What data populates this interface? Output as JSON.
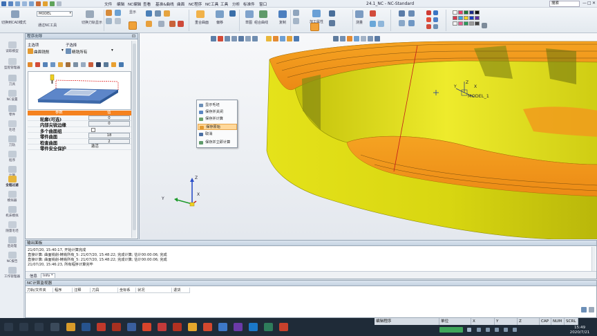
{
  "window": {
    "title": "24.1_NC - NC-Standard",
    "search_placeholder": "搜索",
    "controls": [
      "—",
      "□",
      "✕"
    ]
  },
  "menus": [
    "文件",
    "编辑",
    "NC编辑",
    "查看",
    "基准&曲线",
    "曲面",
    "NC程序",
    "NC工具",
    "工具",
    "分析",
    "标准件",
    "窗口"
  ],
  "ribbon": {
    "combo_value": "MODEL",
    "labels": {
      "switch_cad": "切换到CAD模式",
      "via_nc_tool": "通过NC工具",
      "switch_display": "切换刀轨显示",
      "collapse": "显示",
      "part_compare": "重合曲面",
      "offset": "偏移",
      "sketch": "草图",
      "combine_curves": "组合曲线",
      "copy": "复制",
      "machining_attr": "加工属性",
      "measure": "测量",
      "rotate": "旋转"
    }
  },
  "vtool": [
    {
      "icon": "import-model-icon",
      "label": "读取模型"
    },
    {
      "icon": "section-management-icon",
      "label": "型腔管理器"
    },
    {
      "icon": "tool-icon",
      "label": "刀具"
    },
    {
      "icon": "nc-setup-icon",
      "label": "NC设置"
    },
    {
      "icon": "parts-icon",
      "label": "零件"
    },
    {
      "icon": "stock-icon",
      "label": "毛坯"
    },
    {
      "icon": "cutter-icon",
      "label": "刀轨"
    },
    {
      "icon": "program-icon",
      "label": "程序"
    },
    {
      "icon": "calculate-icon",
      "label": "计算"
    },
    {
      "icon": "full-pass-icon",
      "label": "全程过滤"
    },
    {
      "icon": "simulator-icon",
      "label": "模拟器"
    },
    {
      "icon": "machine-sim-icon",
      "label": "机床模拟"
    },
    {
      "icon": "save-as-icon",
      "label": "随量毛坯"
    },
    {
      "icon": "post-processor-icon",
      "label": "后处理"
    },
    {
      "icon": "nc-report-icon",
      "label": "NC报告"
    },
    {
      "icon": "worksheet-icon",
      "label": "工作管理器"
    }
  ],
  "wizard": {
    "title": "程序向导",
    "main_option_label": "主选项",
    "sub_option_label": "子选择",
    "main_option_value": "曲面铣削",
    "sub_option_value": "精铣所有",
    "table_header_param": "参数",
    "table_header_value": "值",
    "rows": [
      {
        "name": "轮廓(可选)",
        "value": "0",
        "kind": "box"
      },
      {
        "name": "内部尖锐边缘",
        "value": "0",
        "kind": "box"
      },
      {
        "name": "多个曲面组",
        "value": "",
        "kind": "check"
      },
      {
        "name": "零件曲面",
        "value": "18",
        "kind": "box"
      },
      {
        "name": "检查曲面",
        "value": "2",
        "kind": "box"
      },
      {
        "name": "零件安全保护",
        "value": "激活",
        "kind": "text"
      }
    ]
  },
  "context_menu": {
    "items": [
      {
        "label": "显示毛坯",
        "highlight": false
      },
      {
        "label": "保存并关闭",
        "highlight": false
      },
      {
        "label": "保存并计算",
        "highlight": false
      },
      {
        "label": "保存原始",
        "highlight": true
      },
      {
        "label": "取消",
        "highlight": false
      },
      {
        "label": "保存并立即计算",
        "highlight": false
      }
    ]
  },
  "viewport": {
    "coord_label": "MODEL_1",
    "axis_x": "X",
    "axis_y": "Y",
    "axis_z": "Z",
    "triad_x": "X",
    "triad_y": "Y",
    "triad_z": "Z"
  },
  "output": {
    "title": "输出面板",
    "lines": [
      "21/07/20, 15:40:17, 开始计算完成",
      "直接计算: 曲面铣削-精铣所有_5: 21/07/20, 15:48:22; 完成计算; 估计00:00:06; 完成",
      "直接计算: 曲面铣削-精铣所有_5: 21/07/20, 15:48:22; 完成计算; 估计00:00:06; 完成",
      "21/07/20, 15:46:23, 所有程序计算完毕"
    ],
    "tabs": [
      "信息",
      "Info *"
    ]
  },
  "monitor": {
    "title": "NC计算监视器",
    "columns": [
      "刀轨/文件夹",
      "程序",
      "注释",
      "刀具",
      "坐标系",
      "状况",
      "退货"
    ]
  },
  "statusbar": {
    "mode": "编辑程序",
    "unit_label": "单位",
    "x_label": "X",
    "y_label": "Y",
    "z_label": "Z",
    "caps": "CAP",
    "num": "NUM",
    "scrl": "SCRL"
  },
  "clock": {
    "time": "15:49",
    "date": "2020/7/21"
  },
  "colors": {
    "accent_orange": "#f5821f",
    "part_yellow": "#e3e41c",
    "part_orange": "#f39a1e",
    "taskbar": "#1f2b38"
  }
}
